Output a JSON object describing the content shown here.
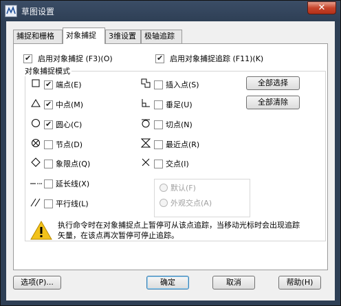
{
  "window": {
    "title": "草图设置",
    "close_glyph": "✕"
  },
  "tabs": [
    {
      "label": "捕捉和栅格"
    },
    {
      "label": "对象捕捉"
    },
    {
      "label": "3维设置"
    },
    {
      "label": "极轴追踪"
    }
  ],
  "options": {
    "enable_osnap": {
      "label": "启用对象捕捉 (F3)(O)",
      "checked": true
    },
    "enable_tracking": {
      "label": "启用对象捕捉追踪 (F11)(K)",
      "checked": true
    }
  },
  "modes_title": "对象捕捉模式",
  "modes_left": [
    {
      "label": "端点(E)",
      "checked": true,
      "icon": "square-icon"
    },
    {
      "label": "中点(M)",
      "checked": true,
      "icon": "triangle-icon"
    },
    {
      "label": "圆心(C)",
      "checked": true,
      "icon": "circle-icon"
    },
    {
      "label": "节点(D)",
      "checked": false,
      "icon": "node-icon"
    },
    {
      "label": "象限点(Q)",
      "checked": false,
      "icon": "diamond-icon"
    },
    {
      "label": "延长线(X)",
      "checked": false,
      "icon": "extension-icon"
    },
    {
      "label": "平行线(L)",
      "checked": false,
      "icon": "parallel-icon"
    }
  ],
  "modes_right": [
    {
      "label": "插入点(S)",
      "checked": false,
      "icon": "insert-icon"
    },
    {
      "label": "垂足(U)",
      "checked": false,
      "icon": "perpendicular-icon"
    },
    {
      "label": "切点(N)",
      "checked": false,
      "icon": "tangent-icon"
    },
    {
      "label": "最近点(R)",
      "checked": false,
      "icon": "nearest-icon"
    },
    {
      "label": "交点(I)",
      "checked": false,
      "icon": "intersection-icon"
    }
  ],
  "select_all_label": "全部选择",
  "clear_all_label": "全部清除",
  "radio": {
    "default_label": "默认(F)",
    "apparent_label": "外观交点(A)"
  },
  "notice": "执行命令时在对象捕捉点上暂停可从该点追踪，当移动光标时会出现追踪矢量，在该点再次暂停可停止追踪。",
  "footer": {
    "options_label": "选项(P)...",
    "ok_label": "确定",
    "cancel_label": "取消",
    "help_label": "帮助(H)"
  }
}
